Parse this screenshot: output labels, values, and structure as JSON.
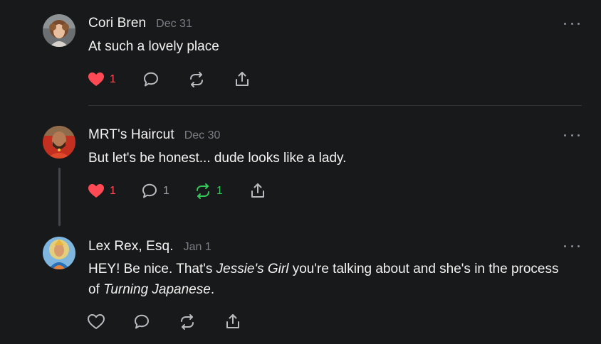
{
  "posts": [
    {
      "author": "Cori Bren",
      "date": "Dec 31",
      "avatar_icon": "avatar-photo-curly-hair-woman",
      "text": "At such a lovely place",
      "likes": "1",
      "liked": true,
      "comments": "",
      "restacks": "",
      "restacked": false
    },
    {
      "author": "MRT's Haircut",
      "date": "Dec 30",
      "avatar_icon": "avatar-photo-bearded-man-red",
      "text": "But let's be honest... dude looks like a lady.",
      "likes": "1",
      "liked": true,
      "comments": "1",
      "restacks": "1",
      "restacked": true
    },
    {
      "author": "Lex Rex, Esq.",
      "date": "Jan 1",
      "avatar_icon": "avatar-illustration-deity",
      "text_parts": [
        "HEY! Be nice. That's ",
        "Jessie's Girl",
        " you're talking about and she's in the process of ",
        "Turning Japanese",
        "."
      ],
      "likes": "",
      "liked": false,
      "comments": "",
      "restacks": "",
      "restacked": false
    }
  ],
  "colors": {
    "background": "#18191b",
    "like_active": "#ff4a55",
    "restack_active": "#35c759",
    "muted_text": "#7b7d82",
    "icon_default": "#b9bbbf"
  },
  "icons": {
    "like": "heart-icon",
    "comment": "speech-bubble-icon",
    "restack": "restack-arrows-icon",
    "share": "share-icon",
    "more": "more-options-icon"
  }
}
